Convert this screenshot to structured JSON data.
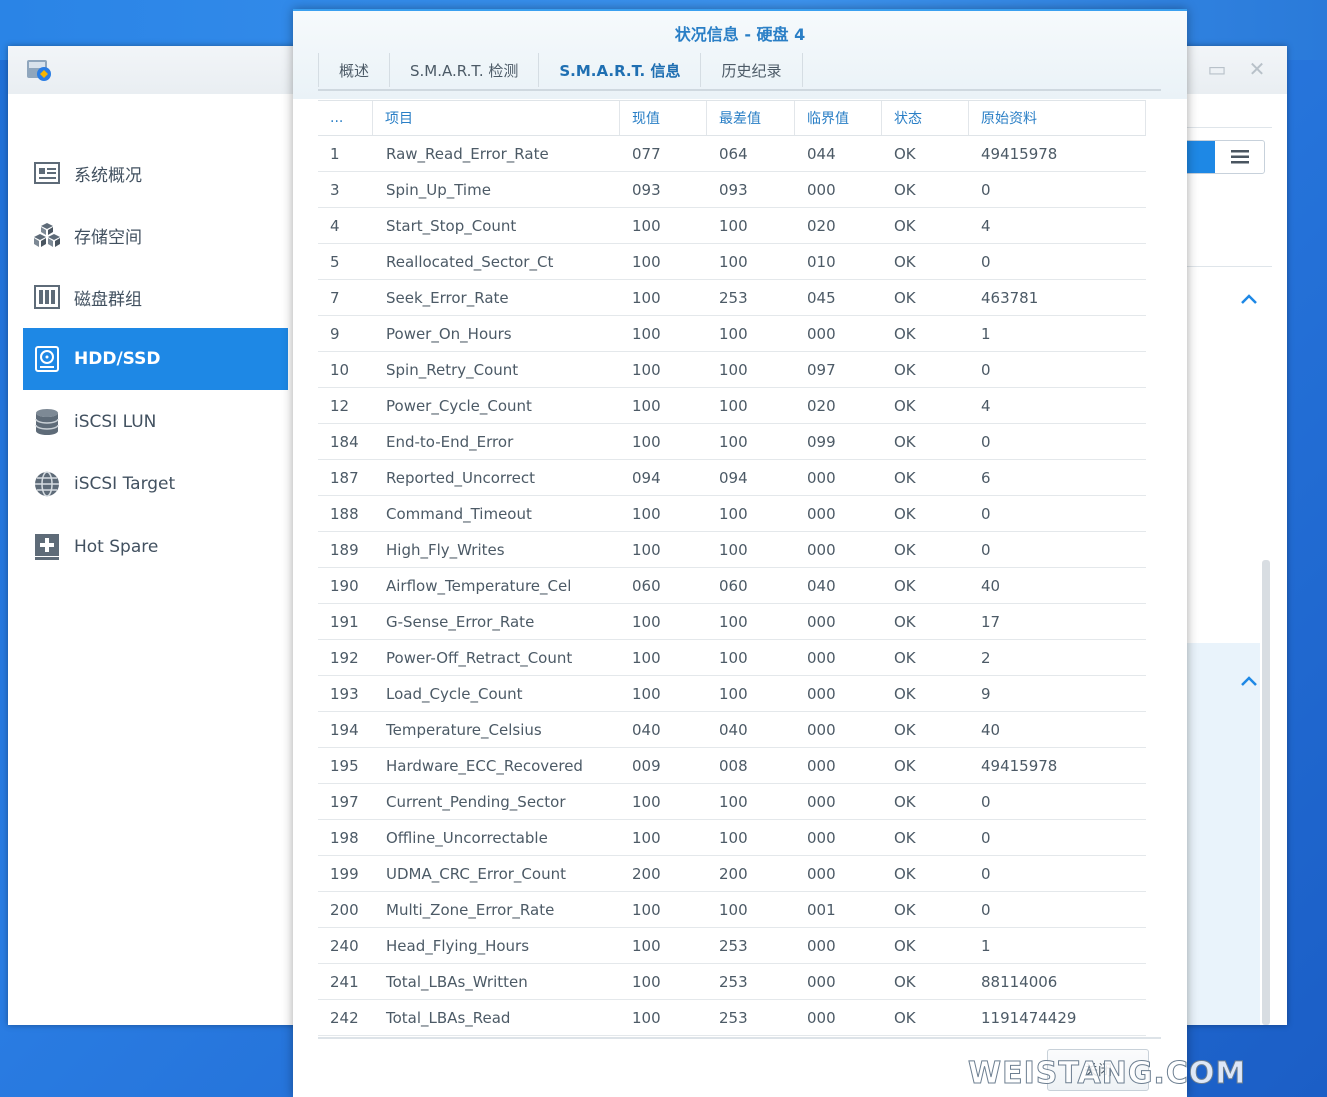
{
  "sidebar": {
    "items": [
      {
        "label": "系统概况",
        "icon": "overview-icon"
      },
      {
        "label": "存储空间",
        "icon": "storage-cubes-icon"
      },
      {
        "label": "磁盘群组",
        "icon": "disk-group-icon"
      },
      {
        "label": "HDD/SSD",
        "icon": "hdd-icon",
        "active": true
      },
      {
        "label": "iSCSI LUN",
        "icon": "database-icon"
      },
      {
        "label": "iSCSI Target",
        "icon": "globe-icon"
      },
      {
        "label": "Hot Spare",
        "icon": "hot-spare-icon"
      }
    ]
  },
  "dialog": {
    "title": "状况信息 - 硬盘 4",
    "tabs": [
      {
        "label": "概述"
      },
      {
        "label": "S.M.A.R.T. 检测"
      },
      {
        "label": "S.M.A.R.T. 信息",
        "active": true
      },
      {
        "label": "历史纪录"
      }
    ],
    "columns": [
      "...",
      "项目",
      "现值",
      "最差值",
      "临界值",
      "状态",
      "原始资料"
    ],
    "rows": [
      [
        "1",
        "Raw_Read_Error_Rate",
        "077",
        "064",
        "044",
        "OK",
        "49415978"
      ],
      [
        "3",
        "Spin_Up_Time",
        "093",
        "093",
        "000",
        "OK",
        "0"
      ],
      [
        "4",
        "Start_Stop_Count",
        "100",
        "100",
        "020",
        "OK",
        "4"
      ],
      [
        "5",
        "Reallocated_Sector_Ct",
        "100",
        "100",
        "010",
        "OK",
        "0"
      ],
      [
        "7",
        "Seek_Error_Rate",
        "100",
        "253",
        "045",
        "OK",
        "463781"
      ],
      [
        "9",
        "Power_On_Hours",
        "100",
        "100",
        "000",
        "OK",
        "1"
      ],
      [
        "10",
        "Spin_Retry_Count",
        "100",
        "100",
        "097",
        "OK",
        "0"
      ],
      [
        "12",
        "Power_Cycle_Count",
        "100",
        "100",
        "020",
        "OK",
        "4"
      ],
      [
        "184",
        "End-to-End_Error",
        "100",
        "100",
        "099",
        "OK",
        "0"
      ],
      [
        "187",
        "Reported_Uncorrect",
        "094",
        "094",
        "000",
        "OK",
        "6"
      ],
      [
        "188",
        "Command_Timeout",
        "100",
        "100",
        "000",
        "OK",
        "0"
      ],
      [
        "189",
        "High_Fly_Writes",
        "100",
        "100",
        "000",
        "OK",
        "0"
      ],
      [
        "190",
        "Airflow_Temperature_Cel",
        "060",
        "060",
        "040",
        "OK",
        "40"
      ],
      [
        "191",
        "G-Sense_Error_Rate",
        "100",
        "100",
        "000",
        "OK",
        "17"
      ],
      [
        "192",
        "Power-Off_Retract_Count",
        "100",
        "100",
        "000",
        "OK",
        "2"
      ],
      [
        "193",
        "Load_Cycle_Count",
        "100",
        "100",
        "000",
        "OK",
        "9"
      ],
      [
        "194",
        "Temperature_Celsius",
        "040",
        "040",
        "000",
        "OK",
        "40"
      ],
      [
        "195",
        "Hardware_ECC_Recovered",
        "009",
        "008",
        "000",
        "OK",
        "49415978"
      ],
      [
        "197",
        "Current_Pending_Sector",
        "100",
        "100",
        "000",
        "OK",
        "0"
      ],
      [
        "198",
        "Offline_Uncorrectable",
        "100",
        "100",
        "000",
        "OK",
        "0"
      ],
      [
        "199",
        "UDMA_CRC_Error_Count",
        "200",
        "200",
        "000",
        "OK",
        "0"
      ],
      [
        "200",
        "Multi_Zone_Error_Rate",
        "100",
        "100",
        "001",
        "OK",
        "0"
      ],
      [
        "240",
        "Head_Flying_Hours",
        "100",
        "253",
        "000",
        "OK",
        "1"
      ],
      [
        "241",
        "Total_LBAs_Written",
        "100",
        "253",
        "000",
        "OK",
        "88114006"
      ],
      [
        "242",
        "Total_LBAs_Read",
        "100",
        "253",
        "000",
        "OK",
        "1191474429"
      ]
    ],
    "close_label": "关闭"
  },
  "watermark": "WEISTANG.COM",
  "colors": {
    "accent": "#1e88e5",
    "title": "#2a7fc6",
    "text": "#4c5a66"
  }
}
